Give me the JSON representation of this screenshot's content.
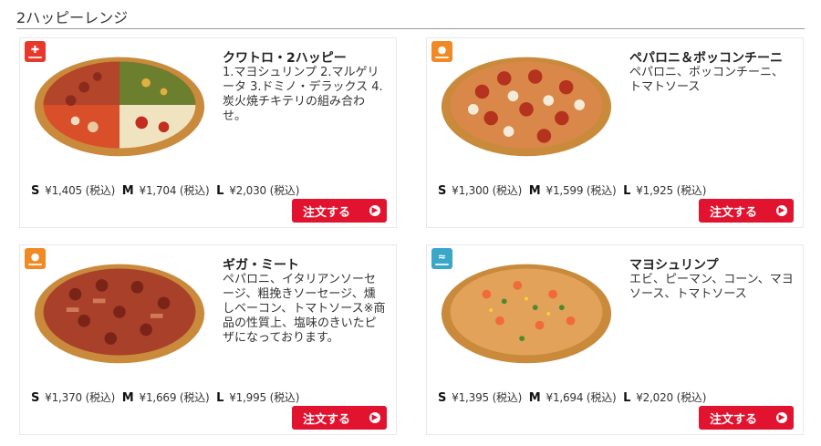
{
  "section": {
    "title": "2ハッピーレンジ"
  },
  "colors": {
    "order_button": "#e1132f",
    "badge_red": "#e8382c",
    "badge_orange": "#f08a24",
    "badge_teal": "#3aa6c8"
  },
  "products": [
    {
      "name": "クワトロ・2ハッピー",
      "description": "1.マヨシュリンプ 2.マルゲリータ 3.ドミノ・デラックス 4.炭火焼チキテリの組み合わせ。",
      "badge": {
        "icon": "quattro-badge-icon",
        "color": "#e8382c"
      },
      "prices": {
        "s_label": "S",
        "s": "¥1,405 (税込)",
        "m_label": "M",
        "m": "¥1,704 (税込)",
        "l_label": "L",
        "l": "¥2,030 (税込)"
      },
      "order_label": "注文する"
    },
    {
      "name": "ペパロニ＆ボッコンチーニ",
      "description": "ペパロニ、ボッコンチーニ、トマトソース",
      "badge": {
        "icon": "meat-badge-icon",
        "color": "#f08a24"
      },
      "prices": {
        "s_label": "S",
        "s": "¥1,300 (税込)",
        "m_label": "M",
        "m": "¥1,599 (税込)",
        "l_label": "L",
        "l": "¥1,925 (税込)"
      },
      "order_label": "注文する"
    },
    {
      "name": "ギガ・ミート",
      "description": "ペパロニ、イタリアンソーセージ、粗挽きソーセージ、燻しベーコン、トマトソース※商品の性質上、塩味のきいたピザになっております。",
      "badge": {
        "icon": "meat-badge-icon",
        "color": "#f08a24"
      },
      "prices": {
        "s_label": "S",
        "s": "¥1,370 (税込)",
        "m_label": "M",
        "m": "¥1,669 (税込)",
        "l_label": "L",
        "l": "¥1,995 (税込)"
      },
      "order_label": "注文する"
    },
    {
      "name": "マヨシュリンプ",
      "description": "エビ、ピーマン、コーン、マヨソース、トマトソース",
      "badge": {
        "icon": "seafood-badge-icon",
        "color": "#3aa6c8"
      },
      "prices": {
        "s_label": "S",
        "s": "¥1,395 (税込)",
        "m_label": "M",
        "m": "¥1,694 (税込)",
        "l_label": "L",
        "l": "¥2,020 (税込)"
      },
      "order_label": "注文する"
    }
  ]
}
